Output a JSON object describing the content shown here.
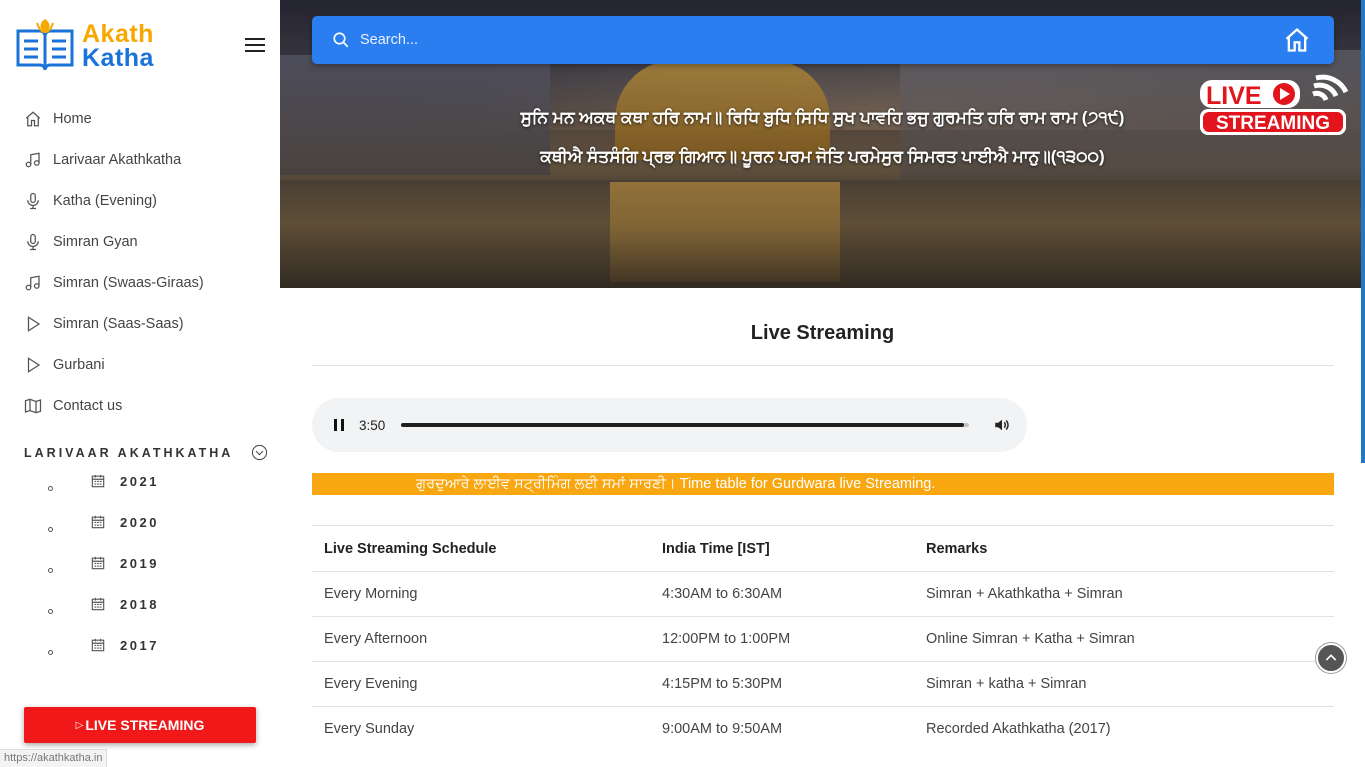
{
  "brand": {
    "line1": "Akath",
    "line2": "Katha"
  },
  "nav": [
    {
      "label": "Home",
      "icon": "home-icon"
    },
    {
      "label": "Larivaar Akathkatha",
      "icon": "music-icon"
    },
    {
      "label": "Katha (Evening)",
      "icon": "mic-icon"
    },
    {
      "label": "Simran Gyan",
      "icon": "mic-icon"
    },
    {
      "label": "Simran (Swaas-Giraas)",
      "icon": "music-icon"
    },
    {
      "label": "Simran (Saas-Saas)",
      "icon": "play-icon"
    },
    {
      "label": "Gurbani",
      "icon": "play-icon"
    },
    {
      "label": "Contact us",
      "icon": "map-icon"
    }
  ],
  "section": {
    "title": "LARIVAAR AKATHKATHA"
  },
  "years": [
    "2021",
    "2020",
    "2019",
    "2018",
    "2017"
  ],
  "live_button": "LIVE STREAMING",
  "status_url": "https://akathkatha.in",
  "search": {
    "placeholder": "Search..."
  },
  "gurbani": {
    "line1": "ਸੁਨਿ ਮਨ ਅਕਥ ਕਥਾ ਹਰਿ ਨਾਮ॥ ਰਿਧਿ ਬੁਧਿ ਸਿਧਿ ਸੁਖ ਪਾਵਹਿ ਭਜੁ ਗੁਰਮਤਿ ਹਰਿ ਰਾਮ ਰਾਮ (੭੧੯)",
    "line2": "ਕਥੀਐ ਸੰਤਸੰਗਿ ਪ੍ਰਭ ਗਿਆਨ॥ ਪੂਰਨ ਪਰਮ ਜੋਤਿ ਪਰਮੇਸੁਰ ਸਿਮਰਤ ਪਾਈਐ ਮਾਨੁ॥(੧੩੦੦)"
  },
  "badge": {
    "line1": "LIVE",
    "line2": "STREAMING"
  },
  "page_heading": "Live Streaming",
  "player": {
    "time": "3:50",
    "progress": 0.99
  },
  "notice": {
    "punjabi": "ਗੁਰਦੁਆਰੇ ਲਾਈਵ ਸਟ੍ਰੀਮਿੰਗ ਲਈ ਸਮਾਂ ਸਾਰਣੀ।",
    "english": " Time table for Gurdwara live Streaming."
  },
  "table": {
    "headers": [
      "Live Streaming Schedule",
      "India Time [IST]",
      "Remarks"
    ],
    "rows": [
      [
        "Every Morning",
        "4:30AM to 6:30AM",
        "Simran + Akathkatha + Simran"
      ],
      [
        "Every Afternoon",
        "12:00PM to 1:00PM",
        "Online Simran + Katha + Simran"
      ],
      [
        "Every Evening",
        "4:15PM to 5:30PM",
        "Simran + katha + Simran"
      ],
      [
        "Every Sunday",
        "9:00AM to 9:50AM",
        "Recorded Akathkatha (2017)"
      ]
    ]
  },
  "colors": {
    "brand_blue": "#1a73d9",
    "brand_orange": "#f7a800",
    "search_bar": "#2a7ef0",
    "live_red": "#f01818",
    "notice_bg": "#f8a710"
  }
}
